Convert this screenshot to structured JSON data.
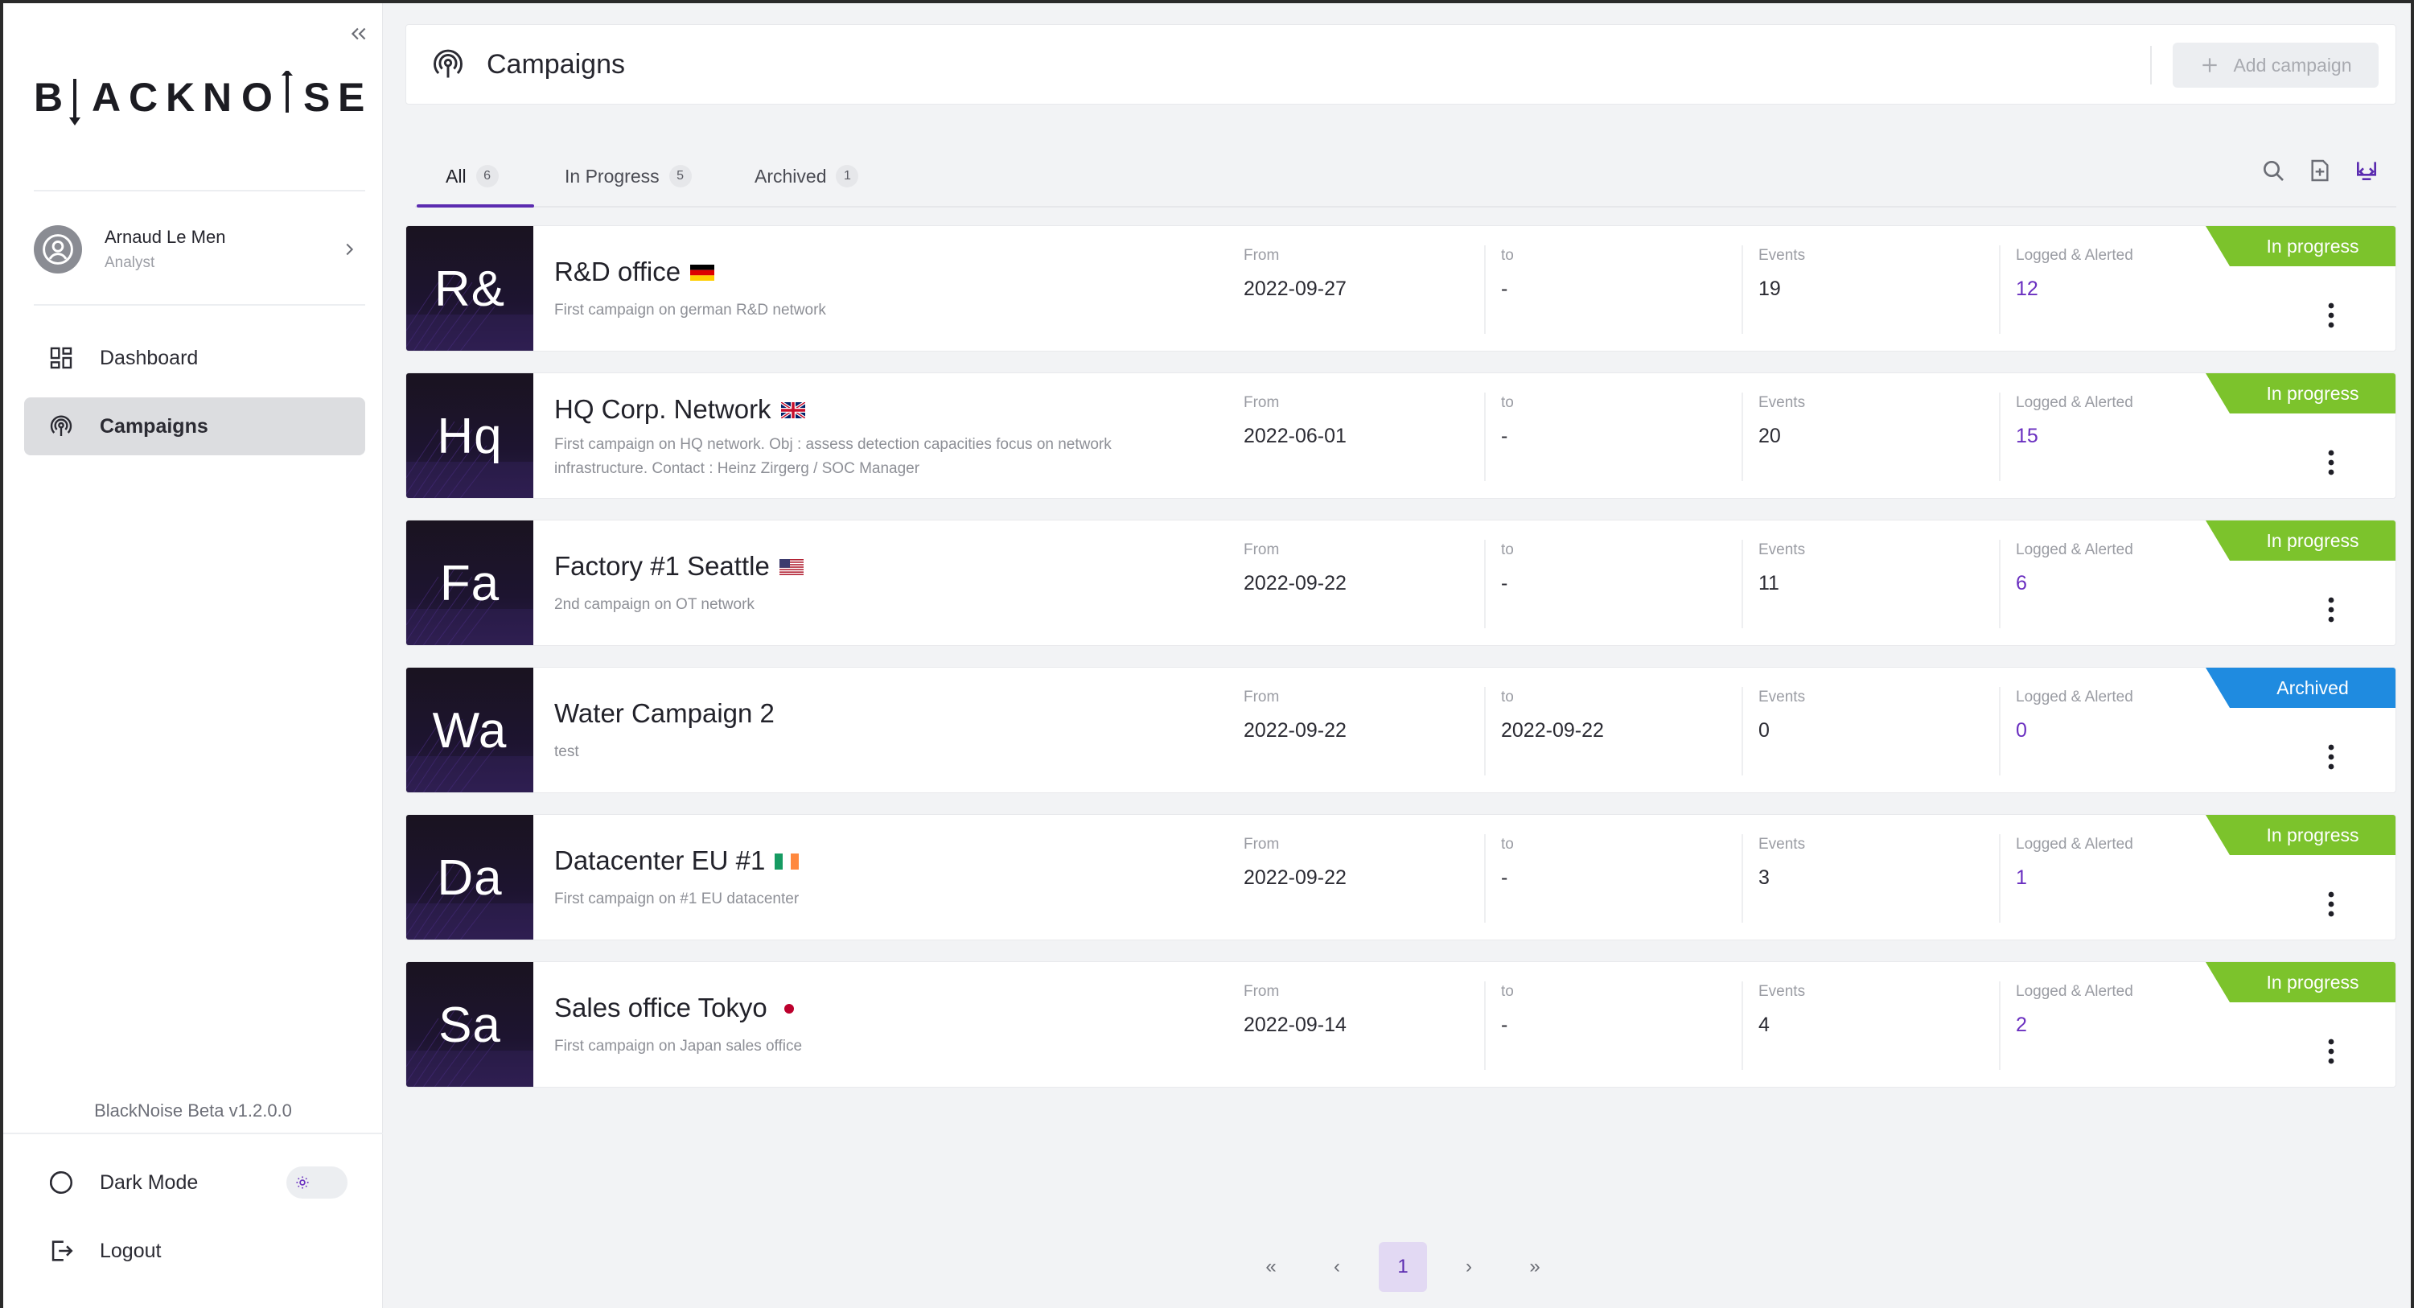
{
  "sidebar": {
    "logo_text": "BLACKNOISE",
    "user": {
      "name": "Arnaud Le Men",
      "role": "Analyst"
    },
    "nav": [
      {
        "label": "Dashboard",
        "icon": "dashboard-grid-icon"
      },
      {
        "label": "Campaigns",
        "icon": "campaigns-radar-icon",
        "active": true
      }
    ],
    "version": "BlackNoise Beta v1.2.0.0",
    "dark_mode_label": "Dark Mode",
    "dark_mode_on": false,
    "logout_label": "Logout"
  },
  "header": {
    "title": "Campaigns",
    "add_button": "Add campaign"
  },
  "tabs": [
    {
      "label": "All",
      "count": "6",
      "active": true
    },
    {
      "label": "In Progress",
      "count": "5"
    },
    {
      "label": "Archived",
      "count": "1"
    }
  ],
  "labels": {
    "from": "From",
    "to": "to",
    "events": "Events",
    "logged": "Logged & Alerted"
  },
  "campaigns": [
    {
      "initials": "R&",
      "name": "R&D office",
      "flag": "germany",
      "desc": "First campaign on german R&D network",
      "from": "2022-09-27",
      "to": "-",
      "events": "19",
      "logged": "12",
      "status": "In progress"
    },
    {
      "initials": "Hq",
      "name": "HQ Corp. Network",
      "flag": "uk",
      "desc": "First campaign on HQ network. Obj : assess detection capacities focus on network infrastructure. Contact : Heinz Zirgerg / SOC Manager",
      "from": "2022-06-01",
      "to": "-",
      "events": "20",
      "logged": "15",
      "status": "In progress"
    },
    {
      "initials": "Fa",
      "name": "Factory #1 Seattle",
      "flag": "usa",
      "desc": "2nd campaign on OT network",
      "from": "2022-09-22",
      "to": "-",
      "events": "11",
      "logged": "6",
      "status": "In progress"
    },
    {
      "initials": "Wa",
      "name": "Water Campaign 2",
      "flag": "",
      "desc": "test",
      "from": "2022-09-22",
      "to": "2022-09-22",
      "events": "0",
      "logged": "0",
      "status": "Archived"
    },
    {
      "initials": "Da",
      "name": "Datacenter EU #1",
      "flag": "ireland",
      "desc": "First campaign on #1 EU datacenter",
      "from": "2022-09-22",
      "to": "-",
      "events": "3",
      "logged": "1",
      "status": "In progress"
    },
    {
      "initials": "Sa",
      "name": "Sales office Tokyo",
      "flag": "japan",
      "desc": "First campaign on Japan sales office",
      "from": "2022-09-14",
      "to": "-",
      "events": "4",
      "logged": "2",
      "status": "In progress"
    }
  ],
  "pagination": {
    "current": "1",
    "first": "«",
    "prev": "‹",
    "next": "›",
    "last": "»"
  },
  "colors": {
    "accent": "#5b2bb0",
    "in_progress": "#7cc32c",
    "archived": "#1f8be0",
    "link": "#6a2fc0"
  }
}
